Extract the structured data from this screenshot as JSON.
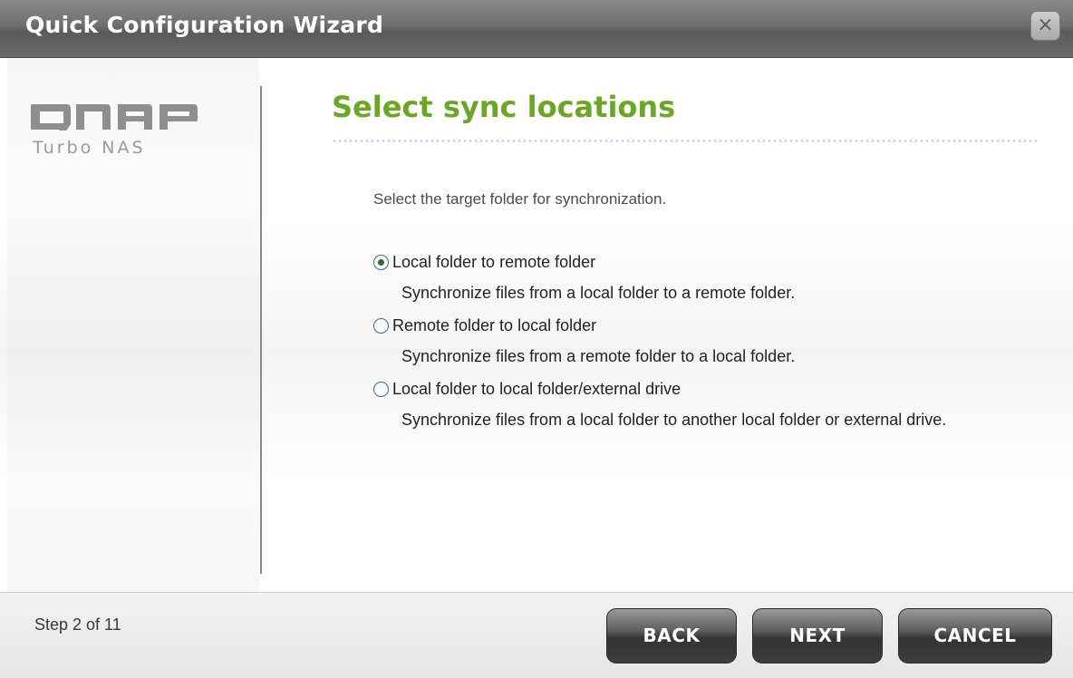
{
  "window": {
    "title": "Quick Configuration Wizard",
    "close_label": "×"
  },
  "branding": {
    "logo_text": "QNAP",
    "subtitle": "Turbo NAS"
  },
  "page": {
    "title": "Select sync locations",
    "instruction": "Select the target folder for synchronization."
  },
  "options": [
    {
      "label": "Local folder to remote folder",
      "description": "Synchronize files from a local folder to a remote folder.",
      "selected": true
    },
    {
      "label": "Remote folder to local folder",
      "description": "Synchronize files from a remote folder to a local folder.",
      "selected": false
    },
    {
      "label": "Local folder to local folder/external drive",
      "description": "Synchronize files from a local folder to another local folder or external drive.",
      "selected": false
    }
  ],
  "footer": {
    "step_text": "Step 2 of 11",
    "back_label": "BACK",
    "next_label": "NEXT",
    "cancel_label": "CANCEL"
  },
  "colors": {
    "title_green": "#6aa824",
    "titlebar_gray": "#6e6e6e",
    "button_dark": "#333333"
  },
  "icons": {
    "close": "close-icon",
    "radio_selected": "radio-checked-icon",
    "radio_unselected": "radio-unchecked-icon"
  }
}
